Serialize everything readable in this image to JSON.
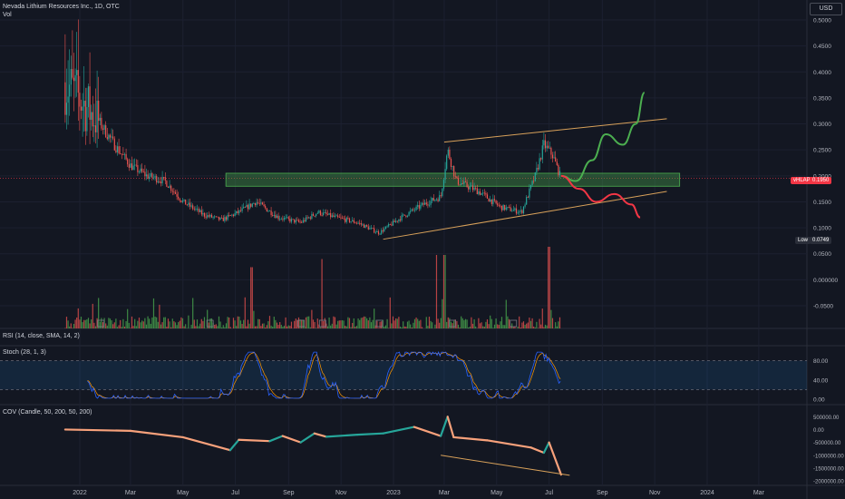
{
  "header": {
    "symbol_line": "Nevada Lithium Resources Inc., 1D, OTC",
    "vol_label": "Vol"
  },
  "currency_button": "USD",
  "price_axis": {
    "ticks": [
      "0.5000",
      "0.4500",
      "0.4000",
      "0.3500",
      "0.3000",
      "0.2500",
      "0.2000",
      "0.1500",
      "0.1000",
      "0.0500",
      "0.000000",
      "-0.0500"
    ],
    "last_price_left": "vHLAP",
    "last_price_right": "0.1950",
    "low_label": "Low",
    "low_value": "0.0749"
  },
  "panels": {
    "rsi_label": "RSI (14, close, SMA, 14, 2)",
    "stoch_label": "Stoch (28, 1, 3)",
    "stoch_ticks": [
      "80.00",
      "40.00",
      "0.00"
    ],
    "cov_label": "COV (Candle, 50, 200, 50, 200)",
    "cov_ticks": [
      "500000.00",
      "0.00",
      "-500000.00",
      "-1000000.00",
      "-1500000.00",
      "-2000000.00"
    ]
  },
  "time_axis": [
    "2022",
    "Mar",
    "May",
    "Jul",
    "Sep",
    "Nov",
    "2023",
    "Mar",
    "May",
    "Jul",
    "Sep",
    "Nov",
    "2024",
    "Mar"
  ],
  "chart_data": {
    "type": "candlestick",
    "series_name": "Nevada Lithium Resources Inc.",
    "interval": "1D",
    "exchange": "OTC",
    "currency": "USD",
    "ylim": [
      -0.07,
      0.52
    ],
    "last_price": 0.195,
    "low": 0.0749,
    "close_path": [
      {
        "x": "2021-12-15",
        "y": 0.38
      },
      {
        "x": "2022-01-05",
        "y": 0.34
      },
      {
        "x": "2022-01-25",
        "y": 0.3
      },
      {
        "x": "2022-02-10",
        "y": 0.26
      },
      {
        "x": "2022-03-01",
        "y": 0.22
      },
      {
        "x": "2022-03-20",
        "y": 0.2
      },
      {
        "x": "2022-04-10",
        "y": 0.19
      },
      {
        "x": "2022-05-01",
        "y": 0.15
      },
      {
        "x": "2022-05-25",
        "y": 0.125
      },
      {
        "x": "2022-06-15",
        "y": 0.115
      },
      {
        "x": "2022-07-05",
        "y": 0.13
      },
      {
        "x": "2022-07-25",
        "y": 0.15
      },
      {
        "x": "2022-08-20",
        "y": 0.12
      },
      {
        "x": "2022-09-15",
        "y": 0.11
      },
      {
        "x": "2022-10-05",
        "y": 0.13
      },
      {
        "x": "2022-10-25",
        "y": 0.12
      },
      {
        "x": "2022-11-20",
        "y": 0.11
      },
      {
        "x": "2022-12-15",
        "y": 0.09
      },
      {
        "x": "2023-01-10",
        "y": 0.12
      },
      {
        "x": "2023-02-05",
        "y": 0.145
      },
      {
        "x": "2023-02-25",
        "y": 0.16
      },
      {
        "x": "2023-03-05",
        "y": 0.25
      },
      {
        "x": "2023-03-15",
        "y": 0.19
      },
      {
        "x": "2023-04-10",
        "y": 0.17
      },
      {
        "x": "2023-05-05",
        "y": 0.14
      },
      {
        "x": "2023-05-30",
        "y": 0.13
      },
      {
        "x": "2023-06-15",
        "y": 0.2
      },
      {
        "x": "2023-06-25",
        "y": 0.26
      },
      {
        "x": "2023-07-05",
        "y": 0.24
      },
      {
        "x": "2023-07-15",
        "y": 0.195
      }
    ],
    "annotations": {
      "support_zone": {
        "from": "2022-06-20",
        "to": "2023-11-30",
        "low": 0.18,
        "high": 0.205
      },
      "channel_upper": [
        {
          "x": "2023-03-01",
          "y": 0.265
        },
        {
          "x": "2023-11-15",
          "y": 0.31
        }
      ],
      "channel_lower": [
        {
          "x": "2022-12-20",
          "y": 0.078
        },
        {
          "x": "2023-11-15",
          "y": 0.17
        }
      ],
      "bullish_projection": [
        {
          "x": "2023-07-15",
          "y": 0.2
        },
        {
          "x": "2023-08-01",
          "y": 0.19
        },
        {
          "x": "2023-08-20",
          "y": 0.23
        },
        {
          "x": "2023-09-05",
          "y": 0.28
        },
        {
          "x": "2023-09-25",
          "y": 0.26
        },
        {
          "x": "2023-10-10",
          "y": 0.3
        },
        {
          "x": "2023-10-20",
          "y": 0.36
        }
      ],
      "bearish_projection": [
        {
          "x": "2023-07-15",
          "y": 0.2
        },
        {
          "x": "2023-08-05",
          "y": 0.175
        },
        {
          "x": "2023-08-25",
          "y": 0.15
        },
        {
          "x": "2023-09-15",
          "y": 0.165
        },
        {
          "x": "2023-10-05",
          "y": 0.145
        },
        {
          "x": "2023-10-15",
          "y": 0.12
        }
      ]
    },
    "volume": {
      "from": "2021-12-15",
      "to": "2023-07-15",
      "peak_bars": [
        {
          "x": "2022-07-20",
          "v": 0.75
        },
        {
          "x": "2022-10-10",
          "v": 0.85
        },
        {
          "x": "2023-02-20",
          "v": 0.9
        },
        {
          "x": "2023-03-01",
          "v": 0.9
        },
        {
          "x": "2023-07-01",
          "v": 1.0
        }
      ]
    },
    "stoch": {
      "levels": [
        80,
        20
      ],
      "ylim": [
        0,
        100
      ]
    },
    "cov": {
      "ylim": [
        -2100000,
        650000
      ],
      "path": [
        {
          "x": "2021-12-15",
          "y": 0
        },
        {
          "x": "2022-03-01",
          "y": -50000
        },
        {
          "x": "2022-05-01",
          "y": -300000
        },
        {
          "x": "2022-06-25",
          "y": -800000
        },
        {
          "x": "2022-07-05",
          "y": -400000
        },
        {
          "x": "2022-08-10",
          "y": -450000
        },
        {
          "x": "2022-08-25",
          "y": -250000
        },
        {
          "x": "2022-09-15",
          "y": -500000
        },
        {
          "x": "2022-10-01",
          "y": -150000
        },
        {
          "x": "2022-10-15",
          "y": -280000
        },
        {
          "x": "2022-11-20",
          "y": -200000
        },
        {
          "x": "2022-12-20",
          "y": -150000
        },
        {
          "x": "2023-01-25",
          "y": 100000
        },
        {
          "x": "2023-02-25",
          "y": -250000
        },
        {
          "x": "2023-03-05",
          "y": 500000
        },
        {
          "x": "2023-03-12",
          "y": -300000
        },
        {
          "x": "2023-04-20",
          "y": -420000
        },
        {
          "x": "2023-06-10",
          "y": -700000
        },
        {
          "x": "2023-06-25",
          "y": -900000
        },
        {
          "x": "2023-07-01",
          "y": -500000
        },
        {
          "x": "2023-07-15",
          "y": -1750000
        }
      ],
      "trendline": [
        {
          "x": "2023-02-25",
          "y": -1000000
        },
        {
          "x": "2023-07-25",
          "y": -1780000
        }
      ]
    },
    "colors": {
      "up": "#26a69a",
      "down": "#ef5350",
      "zone": "#4caf50",
      "channel": "#d8a15a",
      "bull": "#4caf50",
      "bear": "#f23645",
      "cov_trend": "#d8a15a"
    }
  }
}
